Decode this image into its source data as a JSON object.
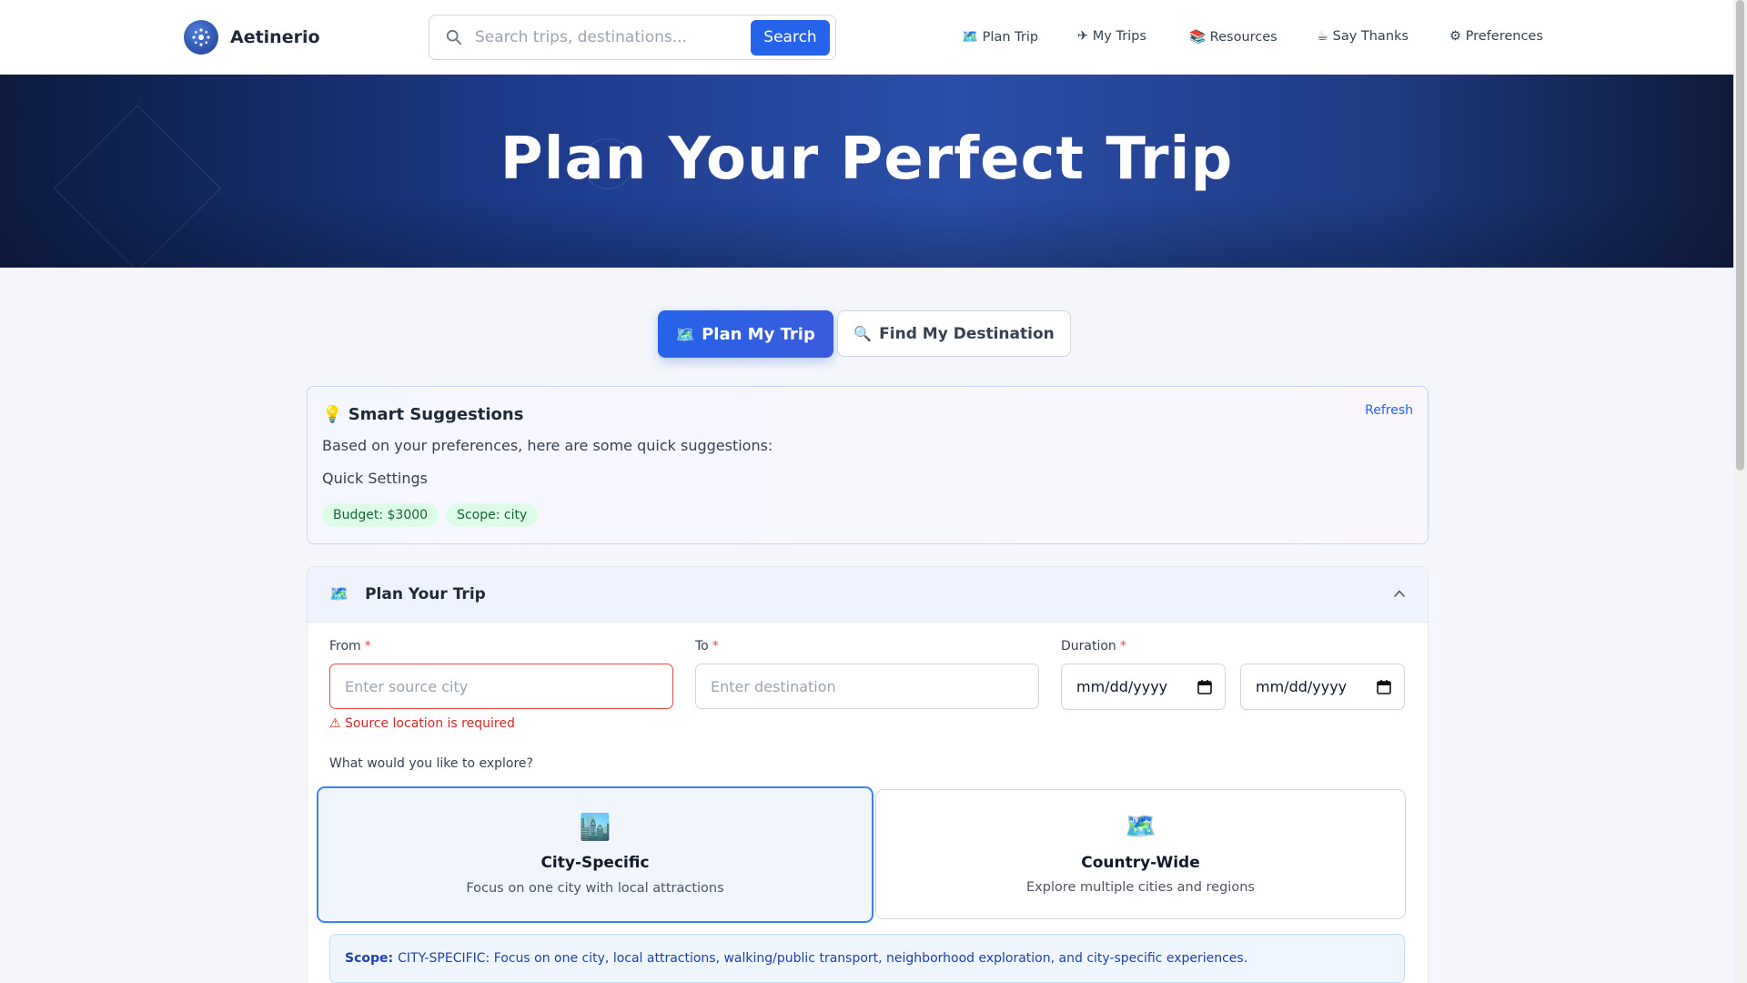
{
  "header": {
    "brand": "Aetinerio",
    "search_placeholder": "Search trips, destinations...",
    "search_button": "Search",
    "nav": [
      {
        "icon": "🗺️",
        "label": "Plan Trip"
      },
      {
        "icon": "✈",
        "label": "My Trips"
      },
      {
        "icon": "📚",
        "label": "Resources"
      },
      {
        "icon": "☕",
        "label": "Say Thanks"
      },
      {
        "icon": "⚙",
        "label": "Preferences"
      }
    ]
  },
  "hero": {
    "title": "Plan Your Perfect Trip"
  },
  "mode_tabs": {
    "plan": {
      "icon": "🗺️",
      "label": "Plan My Trip",
      "active": true
    },
    "find": {
      "icon": "🔍",
      "label": "Find My Destination",
      "active": false
    }
  },
  "suggestions": {
    "icon": "💡",
    "title": "Smart Suggestions",
    "refresh": "Refresh",
    "text": "Based on your preferences, here are some quick suggestions:",
    "subheading": "Quick Settings",
    "chips": [
      "Budget: $3000",
      "Scope: city"
    ]
  },
  "plan": {
    "icon": "🗺️",
    "title": "Plan Your Trip",
    "from_label": "From",
    "from_placeholder": "Enter source city",
    "from_error": "⚠ Source location is required",
    "to_label": "To",
    "to_placeholder": "Enter destination",
    "duration_label": "Duration",
    "start_date": "mm/dd/yyyy",
    "end_date": "mm/dd/yyyy",
    "required_mark": "*",
    "explore_label": "What would you like to explore?",
    "scopes": [
      {
        "icon": "🏙️",
        "title": "City-Specific",
        "desc": "Focus on one city with local attractions",
        "selected": true
      },
      {
        "icon": "🗺️",
        "title": "Country-Wide",
        "desc": "Explore multiple cities and regions",
        "selected": false
      }
    ],
    "scope_note_label": "Scope:",
    "scope_note_text": "CITY-SPECIFIC: Focus on one city, local attractions, walking/public transport, neighborhood exploration, and city-specific experiences."
  },
  "colors": {
    "accent": "#2563eb",
    "error": "#ef4444",
    "chip_bg": "#dcfce7",
    "hero_dark": "#0d1a3d"
  }
}
